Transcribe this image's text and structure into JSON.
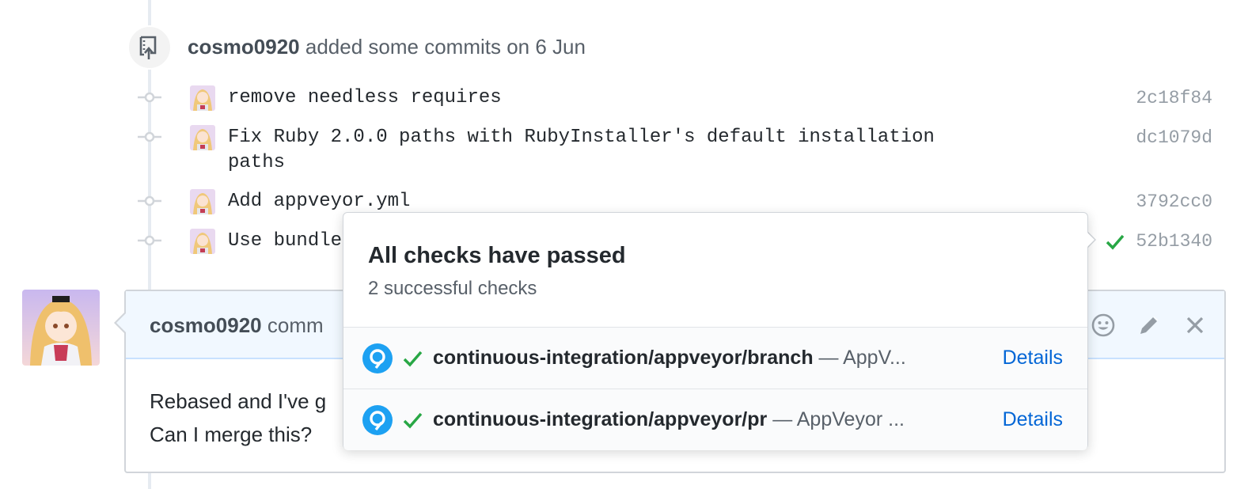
{
  "push_event": {
    "author": "cosmo0920",
    "action_text": " added some commits on 6 Jun",
    "icon": "repo-push-icon"
  },
  "commits": [
    {
      "message": "remove needless requires",
      "sha": "2c18f84"
    },
    {
      "message": "Fix Ruby 2.0.0 paths with RubyInstaller's default installation paths",
      "sha": "dc1079d"
    },
    {
      "message": "Add appveyor.yml",
      "sha": "3792cc0"
    },
    {
      "message": "Use bundle",
      "sha": "52b1340",
      "status": "success"
    }
  ],
  "comment": {
    "author": "cosmo0920",
    "action_text": " comm",
    "body_line1": "Rebased and I've g",
    "body_line2": "Can I merge this?",
    "actions": [
      "smiley-icon",
      "pencil-icon",
      "close-icon"
    ]
  },
  "checks_popover": {
    "title": "All checks have passed",
    "subtitle": "2 successful checks",
    "checks": [
      {
        "context": "continuous-integration/appveyor/branch",
        "description": " — AppV...",
        "link": "Details"
      },
      {
        "context": "continuous-integration/appveyor/pr",
        "description": " — AppVeyor ...",
        "link": "Details"
      }
    ]
  },
  "colors": {
    "success": "#28a745",
    "link": "#0366d6",
    "appveyor": "#1da1f2"
  }
}
